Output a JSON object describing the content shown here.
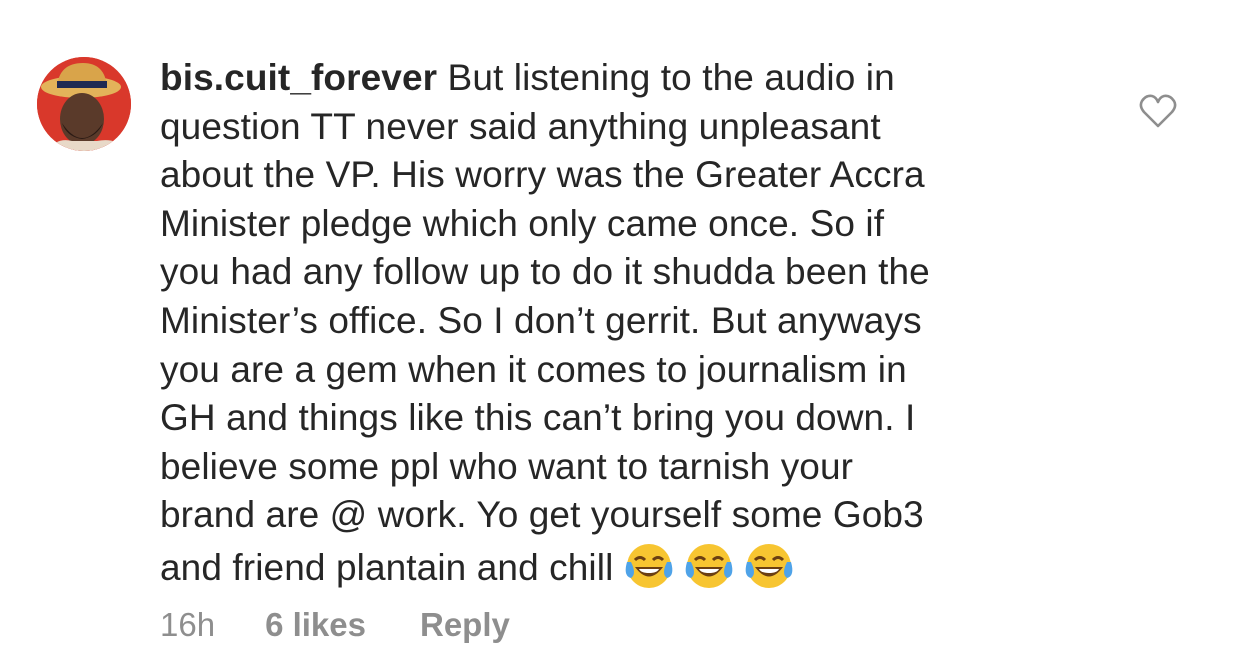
{
  "comment": {
    "username": "bis.cuit_forever",
    "lines": [
      "But listening to the audio in",
      "question TT never said anything unpleasant",
      "about the VP. His worry was the Greater Accra",
      "Minister pledge which only came once. So if",
      "you had any follow up to do it shudda been the",
      "Minister’s office. So I don’t gerrit. But anyways",
      "you are a gem when it comes to journalism in",
      "GH and things like this can’t bring you down. I",
      "believe some ppl who want to tarnish your",
      "brand are @ work. Yo get yourself some Gob3",
      "and friend plantain and chill"
    ],
    "emojis": [
      "tears-of-joy-emoji",
      "tears-of-joy-emoji",
      "tears-of-joy-emoji"
    ]
  },
  "meta": {
    "time": "16h",
    "likes": "6 likes",
    "reply": "Reply"
  },
  "icons": {
    "like": "heart-outline-icon"
  },
  "colors": {
    "text": "#262626",
    "muted": "#8e8e8e",
    "avatar_bg": "#d9382b",
    "emoji_face": "#f7c531"
  }
}
